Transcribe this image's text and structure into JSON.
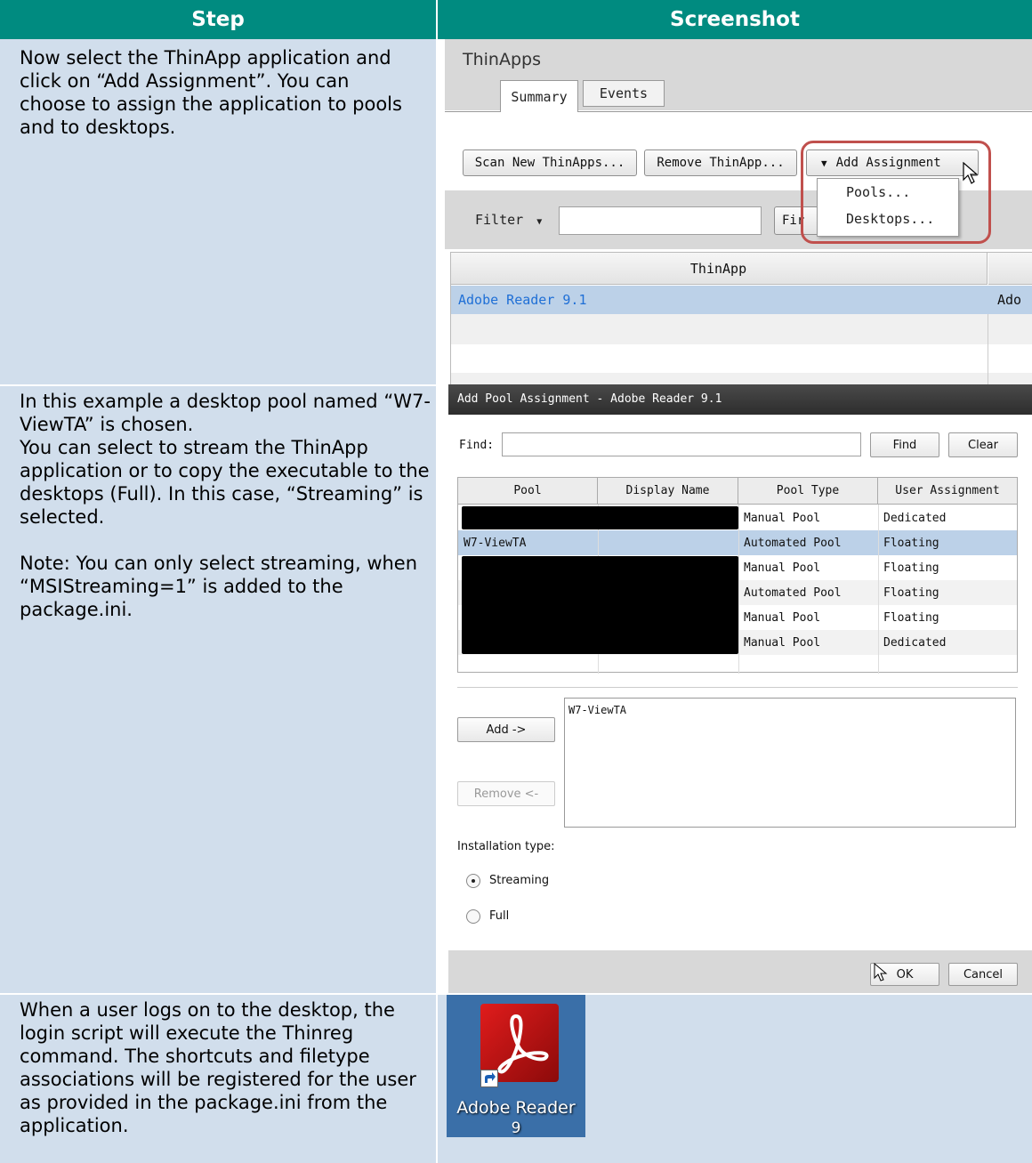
{
  "table": {
    "header_step": "Step",
    "header_screenshot": "Screenshot"
  },
  "rows": [
    {
      "step_text": "Now select the ThinApp application and click on “Add Assignment”. You can choose to assign the application to pools and to desktops."
    },
    {
      "step_text": "In this example a desktop pool named “W7-ViewTA” is chosen.\nYou can select to stream the ThinApp application or to copy the executable to the desktops (Full). In this case, “Streaming” is selected.\n\nNote: You can only select streaming, when “MSIStreaming=1” is added to the package.ini."
    },
    {
      "step_text": "When a user logs on to the desktop, the login script will execute the Thinreg command. The shortcuts and filetype associations will be registered for the user as provided in the package.ini from the application."
    }
  ],
  "shot1": {
    "title": "ThinApps",
    "tabs": [
      "Summary",
      "Events"
    ],
    "buttons": {
      "scan": "Scan New ThinApps...",
      "remove": "Remove ThinApp...",
      "add_assignment": "Add Assignment"
    },
    "menu": [
      "Pools...",
      "Desktops..."
    ],
    "filter_label": "Filter",
    "find_partial": "Fir",
    "column": "ThinApp",
    "column2_partial": "Ado",
    "row_name": "Adobe Reader 9.1",
    "highlight_color": "#c0504d"
  },
  "shot2": {
    "title": "Add Pool Assignment - Adobe Reader 9.1",
    "find_label": "Find:",
    "find_button": "Find",
    "clear_button": "Clear",
    "columns": [
      "Pool",
      "Display Name",
      "Pool Type",
      "User Assignment"
    ],
    "rows": [
      {
        "pool": "",
        "type": "Manual Pool",
        "assign": "Dedicated"
      },
      {
        "pool": "W7-ViewTA",
        "type": "Automated Pool",
        "assign": "Floating"
      },
      {
        "pool": "",
        "type": "Manual Pool",
        "assign": "Floating"
      },
      {
        "pool": "",
        "type": "Automated Pool",
        "assign": "Floating"
      },
      {
        "pool": "",
        "type": "Manual Pool",
        "assign": "Floating"
      },
      {
        "pool": "",
        "type": "Manual Pool",
        "assign": "Dedicated"
      }
    ],
    "add_button": "Add ->",
    "remove_button": "Remove <-",
    "selected_item": "W7-ViewTA",
    "installation_label": "Installation type:",
    "radio_streaming": "Streaming",
    "radio_full": "Full",
    "ok_button": "OK",
    "cancel_button": "Cancel"
  },
  "shot3": {
    "icon_label_line1": "Adobe Reader",
    "icon_label_line2": "9"
  }
}
